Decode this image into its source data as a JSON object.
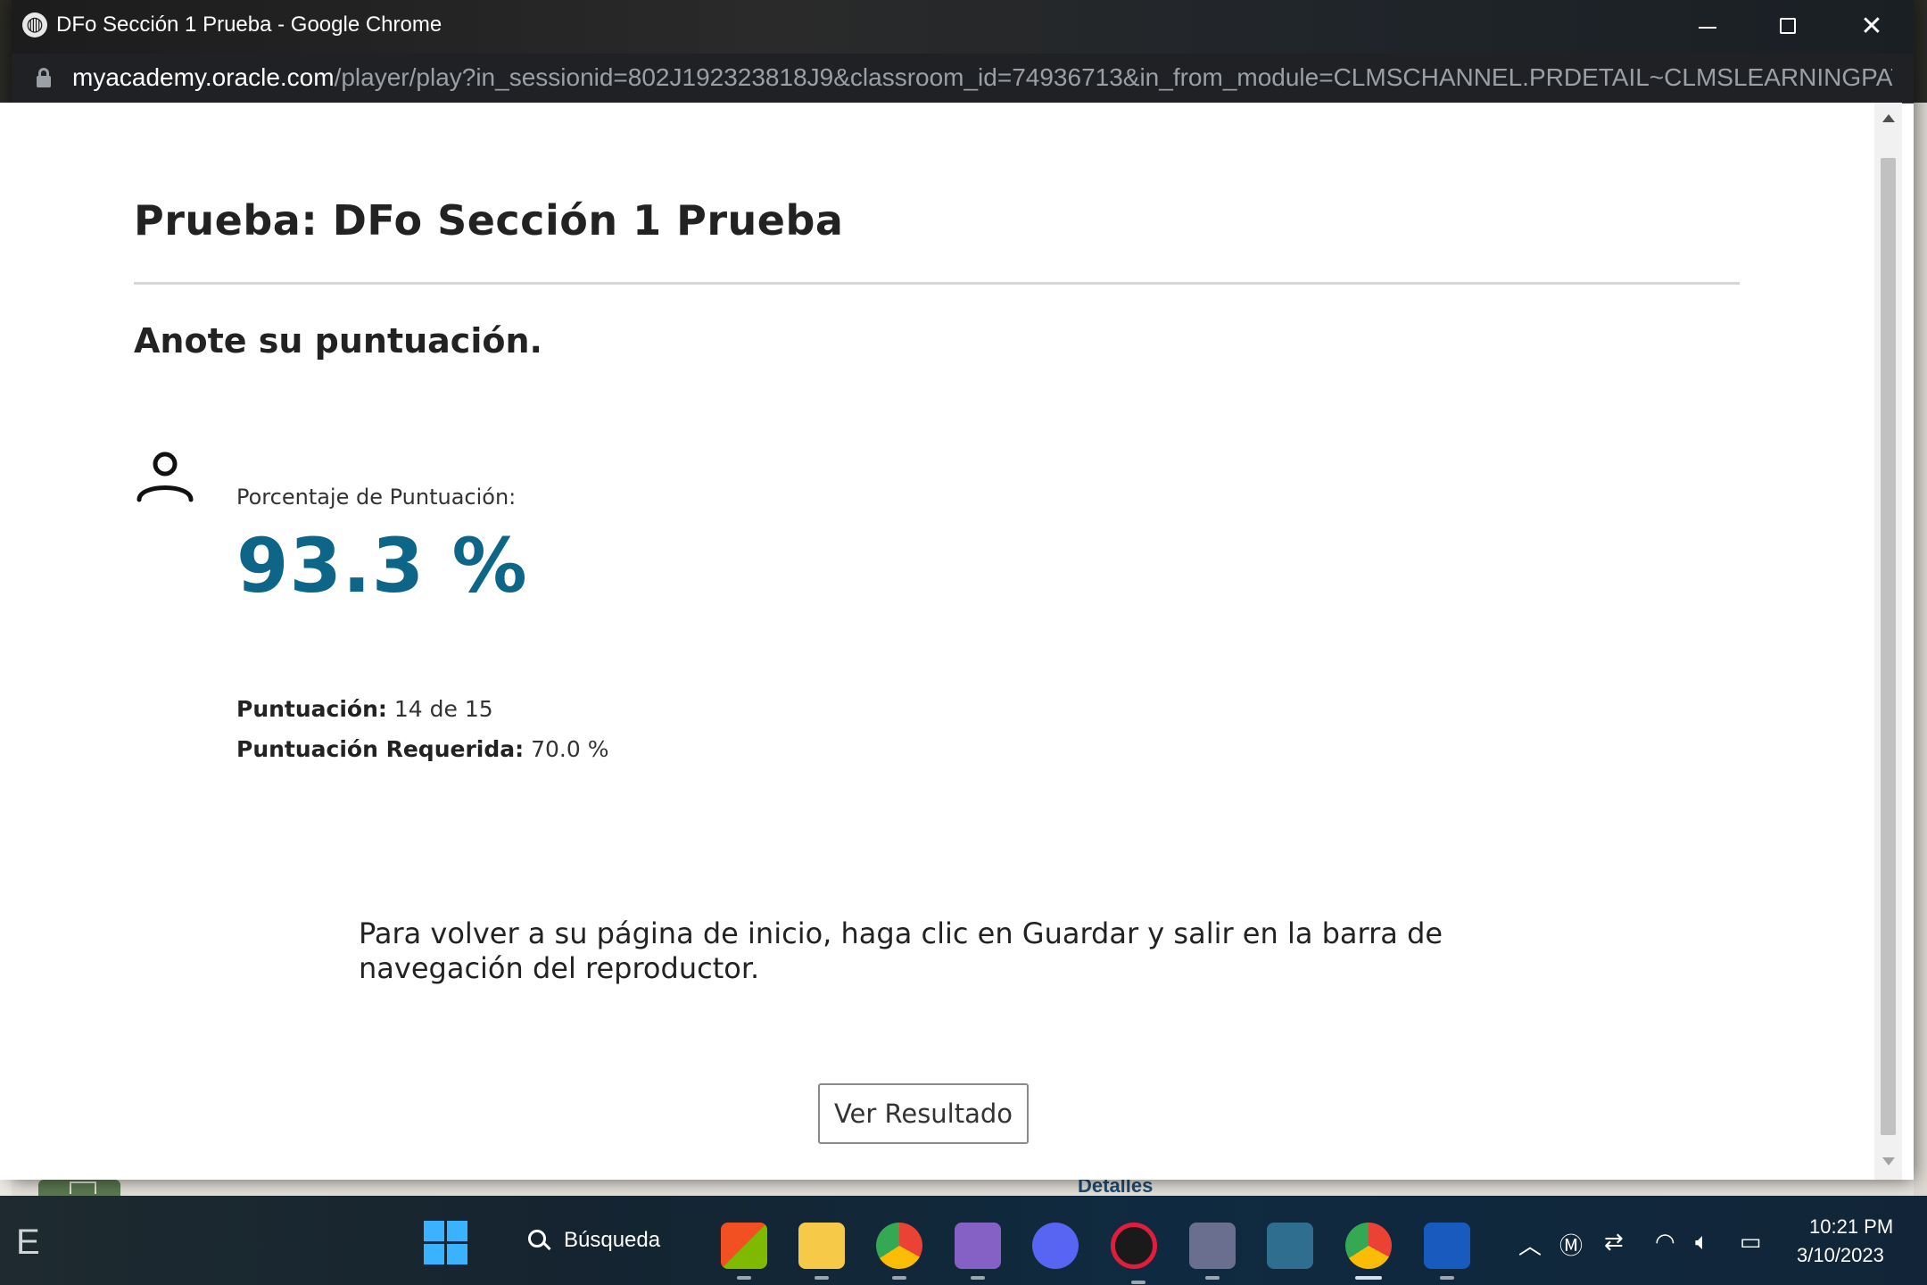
{
  "window": {
    "title": "DFo Sección 1 Prueba - Google Chrome",
    "url_host": "myacademy.oracle.com",
    "url_path": "/player/play?in_sessionid=802J192323818J9&classroom_id=74936713&in_from_module=CLMSCHANNEL.PRDETAIL~CLMSLEARNINGPATH..."
  },
  "page": {
    "heading": "Prueba: DFo Sección 1 Prueba",
    "subheading": "Anote su puntuación.",
    "score_label": "Porcentaje de Puntuación:",
    "score_value": "93.3 %",
    "score_line_label": "Puntuación:",
    "score_line_value": "14 de 15",
    "required_label": "Puntuación Requerida:",
    "required_value": "70.0 %",
    "instructions": "Para volver a su página de inicio, haga clic en Guardar y salir en la barra de navegación del reproductor.",
    "result_button": "Ver Resultado"
  },
  "background_peek": {
    "text": "Detalles"
  },
  "taskbar": {
    "search_label": "Búsqueda",
    "clock_time": "10:21 PM",
    "clock_date": "3/10/2023",
    "apps": [
      "microsoft-store-icon",
      "file-explorer-icon",
      "chrome-icon",
      "visual-studio-icon",
      "discord-icon",
      "opera-icon",
      "app-icon",
      "mysql-workbench-icon",
      "chrome-active-icon",
      "word-icon"
    ]
  },
  "colors": {
    "score_accent": "#0d6688",
    "titlebar_bg": "#1c1c1c",
    "address_bg": "#202124"
  }
}
